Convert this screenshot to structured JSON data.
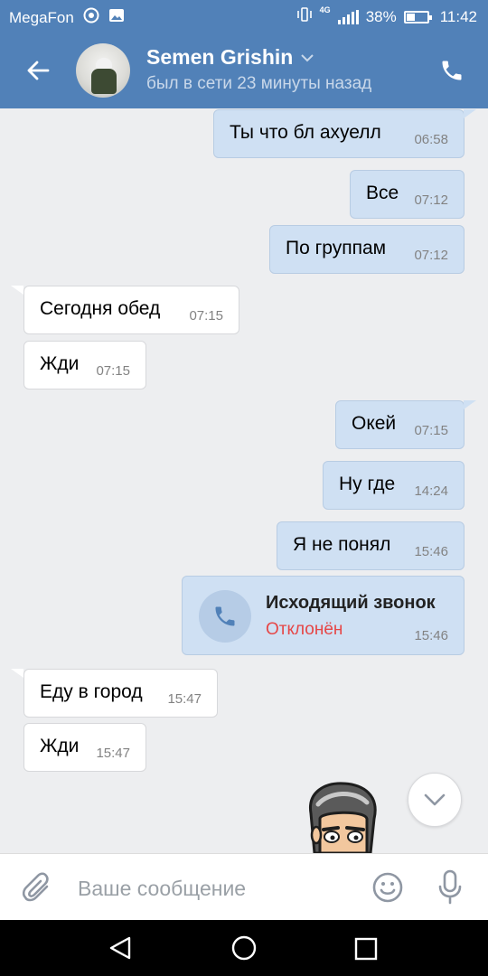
{
  "status_bar": {
    "carrier": "MegaFon",
    "network": "4G",
    "battery": "38%",
    "battery_level": 0.38,
    "time": "11:42"
  },
  "header": {
    "contact_name": "Semen Grishin",
    "status": "был в сети 23 минуты назад",
    "icons": {
      "back": "arrow-left-icon",
      "call": "phone-icon",
      "dropdown": "chevron-down-icon"
    }
  },
  "messages": [
    {
      "direction": "out",
      "text": "Ты что бл ахуелл",
      "time": "06:58"
    },
    {
      "direction": "out",
      "text": "Все",
      "time": "07:12"
    },
    {
      "direction": "out",
      "text": "По группам",
      "time": "07:12"
    },
    {
      "direction": "in",
      "text": "Сегодня обед",
      "time": "07:15"
    },
    {
      "direction": "in",
      "text": "Жди",
      "time": "07:15"
    },
    {
      "direction": "out",
      "text": "Окей",
      "time": "07:15"
    },
    {
      "direction": "out",
      "text": "Ну где",
      "time": "14:24"
    },
    {
      "direction": "out",
      "text": "Я не понял",
      "time": "15:46"
    },
    {
      "direction": "in",
      "text": "Еду в город",
      "time": "15:47"
    },
    {
      "direction": "in",
      "text": "Жди",
      "time": "15:47"
    }
  ],
  "call": {
    "title": "Исходящий звонок",
    "status": "Отклонён",
    "time": "15:46",
    "status_color": "#e64646"
  },
  "composer": {
    "placeholder": "Ваше сообщение",
    "icons": {
      "attach": "paperclip-icon",
      "emoji": "smiley-icon",
      "mic": "microphone-icon"
    }
  },
  "colors": {
    "brand": "#5181b8",
    "outgoing_bubble": "#cfe0f3",
    "incoming_bubble": "#ffffff",
    "background": "#edeef0"
  }
}
